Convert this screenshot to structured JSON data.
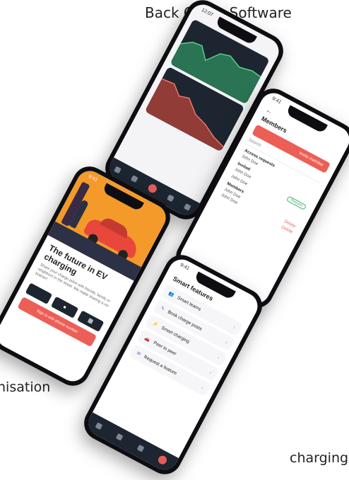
{
  "captions": {
    "top": "Back Office Software",
    "middle": "nisation",
    "bottom": "charging"
  },
  "phone_backoffice": {
    "status_time": "12:07"
  },
  "phone_members": {
    "status_time": "9:41",
    "title": "Members",
    "invite_label": "Invite member",
    "search_placeholder": "Search",
    "access_requests": "Access requests",
    "invited": "Invited",
    "members": "Members",
    "rows": [
      {
        "name": "John Doe",
        "action": ""
      },
      {
        "name": "John Doe",
        "action": "Request"
      },
      {
        "name": "John Doe",
        "action": ""
      },
      {
        "name": "John Doe",
        "action": "Delete"
      },
      {
        "name": "John Doe",
        "action": "Delete"
      }
    ]
  },
  "phone_ev": {
    "status_time": "9:41",
    "title": "The future in EV charging",
    "body": "Share your charge point with friends, family or neighbors in the street. We make sharing a no-brainer!",
    "cta": "Sign in with phone number"
  },
  "phone_features": {
    "status_time": "9:41",
    "title": "Smart features",
    "items": [
      {
        "icon": "team-icon",
        "glyph": "👥",
        "label": "Smart teams"
      },
      {
        "icon": "book-icon",
        "glyph": "✎",
        "label": "Book charge posts"
      },
      {
        "icon": "bolt-icon",
        "glyph": "⚡",
        "label": "Smart charging"
      },
      {
        "icon": "car-icon",
        "glyph": "🚗",
        "label": "Peer to peer"
      },
      {
        "icon": "request-icon",
        "glyph": "✉",
        "label": "Request a feature"
      }
    ]
  },
  "colors": {
    "accent": "#ec5f56",
    "dark": "#1d2530",
    "orange": "#f39a2b"
  }
}
